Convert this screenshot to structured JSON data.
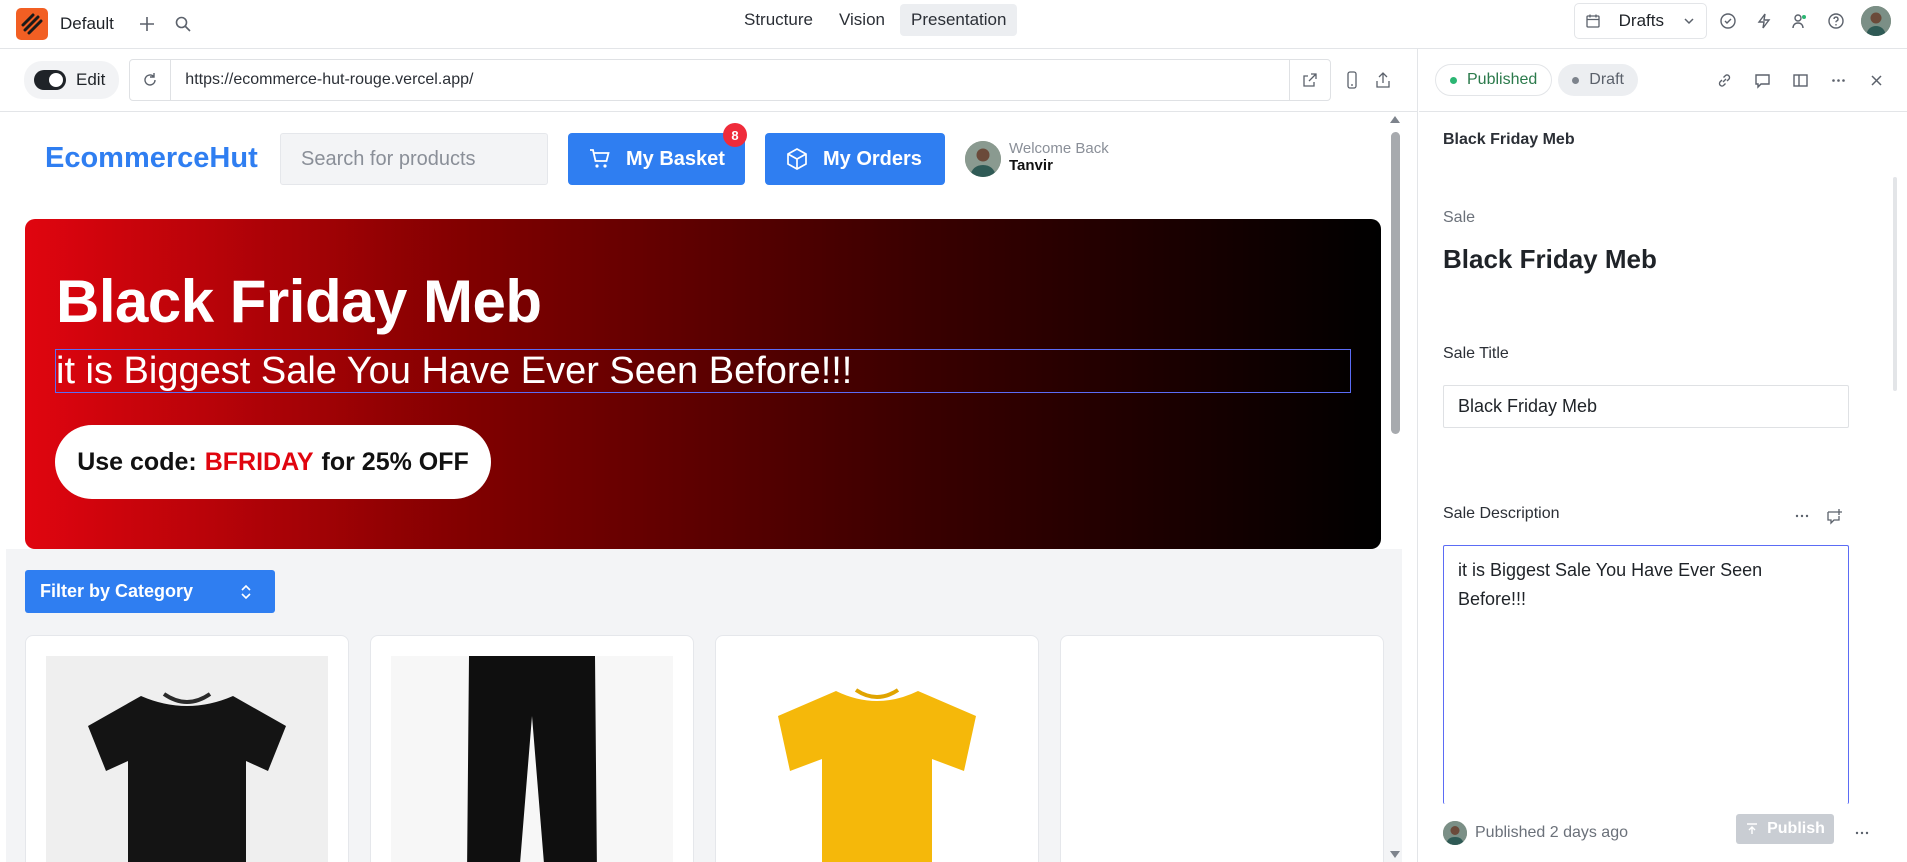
{
  "topbar": {
    "workspace": "Default",
    "tabs": [
      "Structure",
      "Vision",
      "Presentation"
    ],
    "active_tab": "Presentation",
    "drafts_label": "Drafts"
  },
  "preview": {
    "edit_label": "Edit",
    "url": "https://ecommerce-hut-rouge.vercel.app/"
  },
  "site": {
    "brand": "EcommerceHut",
    "search_placeholder": "Search for products",
    "basket_label": "My Basket",
    "basket_count": "8",
    "orders_label": "My Orders",
    "welcome_small": "Welcome Back",
    "welcome_name": "Tanvir",
    "hero": {
      "title": "Black Friday Meb",
      "description": "it is Biggest Sale You Have Ever Seen Before!!!",
      "code_prefix": "Use code:",
      "code": "BFRIDAY",
      "code_suffix": "for 25% OFF"
    },
    "filter_label": "Filter by Category",
    "products": [
      {
        "image": "black-tshirt"
      },
      {
        "image": "black-pants"
      },
      {
        "image": "yellow-tshirt"
      },
      {
        "image": "empty"
      }
    ]
  },
  "panel": {
    "published_label": "Published",
    "draft_label": "Draft",
    "doc_title": "Black Friday Meb",
    "type_label": "Sale",
    "big_title": "Black Friday Meb",
    "sale_title_label": "Sale Title",
    "sale_title_value": "Black Friday Meb",
    "sale_description_label": "Sale Description",
    "sale_description_value": "it is Biggest Sale You Have Ever Seen Before!!!",
    "status_text": "Published 2 days ago",
    "publish_label": "Publish"
  },
  "colors": {
    "brand_blue": "#2f7ef1",
    "hero_red": "#e0050f",
    "badge_red": "#ef2b3a",
    "studio_orange": "#f25f23",
    "focus_indigo": "#5b6cf5"
  }
}
